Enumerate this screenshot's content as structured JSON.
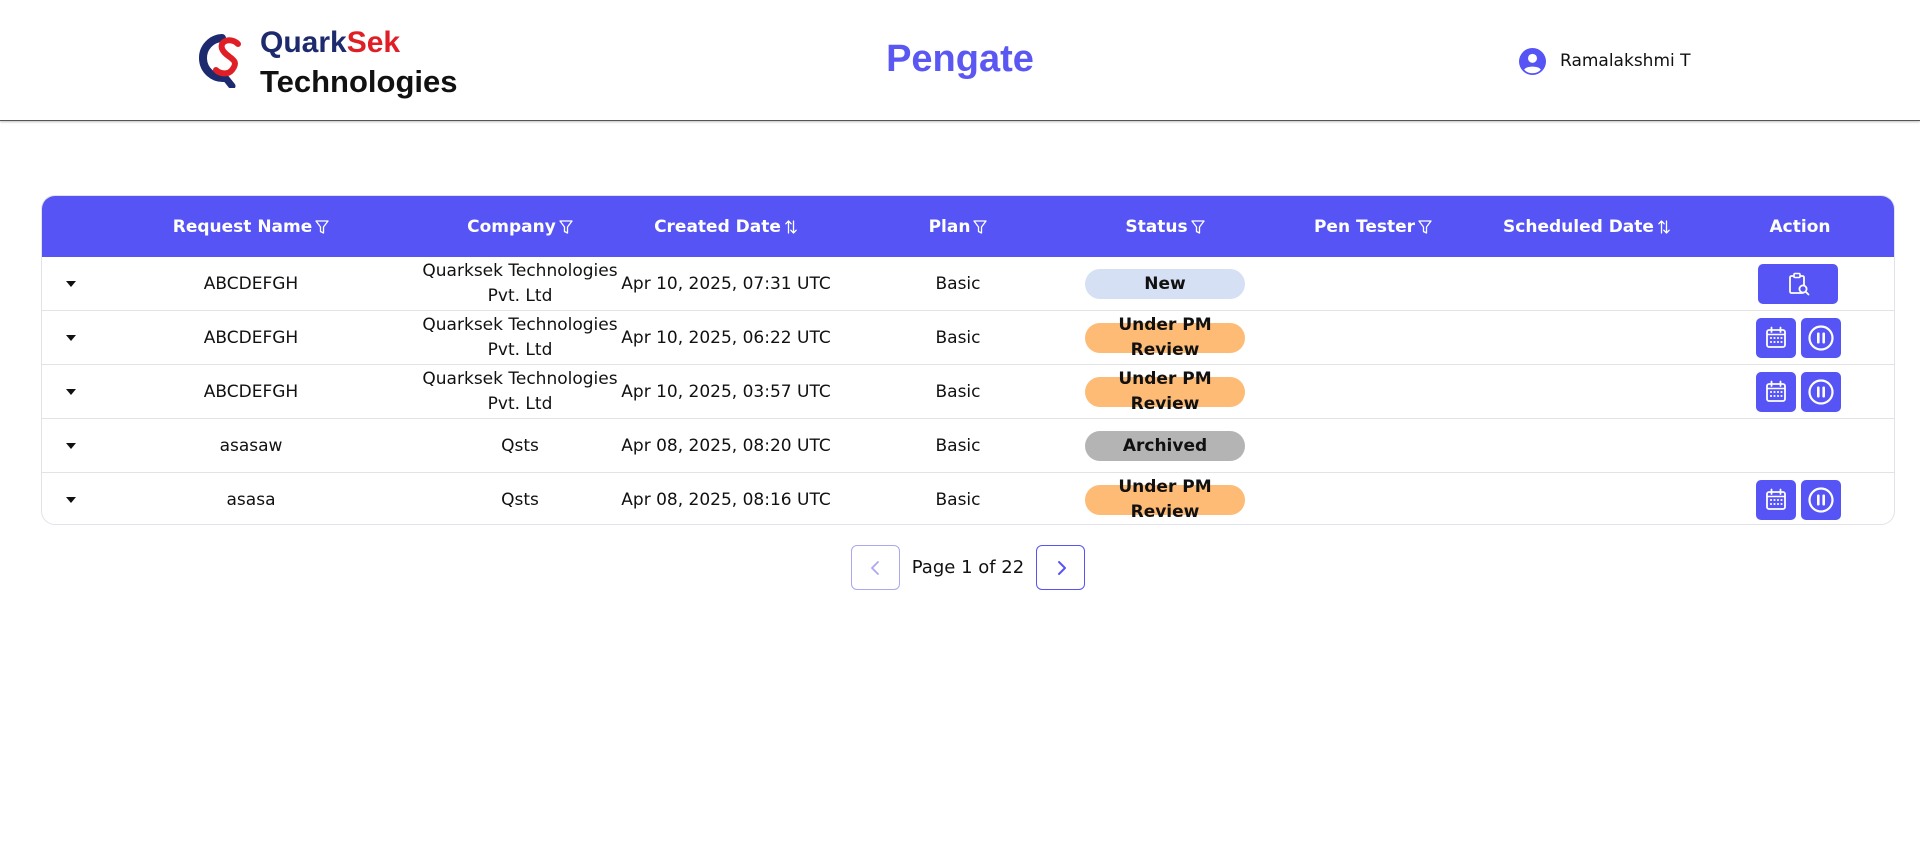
{
  "header": {
    "logo": {
      "word1": "Quark",
      "word2": "Sek",
      "word3": "Technologies"
    },
    "app_title": "Pengate",
    "user": {
      "name": "Ramalakshmi T",
      "icon": "user-circle-icon"
    }
  },
  "colors": {
    "accent": "#5654f5",
    "title": "#5a57f2",
    "logo_navy": "#1e2a6e",
    "logo_red": "#e01e25",
    "badge_new": "#d6e0f4",
    "badge_review": "#fdbb75",
    "badge_archived": "#b4b4b4"
  },
  "table": {
    "columns": [
      {
        "label": "Request Name",
        "icon": "filter-icon"
      },
      {
        "label": "Company",
        "icon": "filter-icon"
      },
      {
        "label": "Created Date",
        "icon": "sort-icon"
      },
      {
        "label": "Plan",
        "icon": "filter-icon"
      },
      {
        "label": "Status",
        "icon": "filter-icon"
      },
      {
        "label": "Pen Tester",
        "icon": "filter-icon"
      },
      {
        "label": "Scheduled Date",
        "icon": "sort-icon"
      },
      {
        "label": "Action",
        "icon": ""
      }
    ],
    "rows": [
      {
        "request_name": "ABCDEFGH",
        "company_line1": "Quarksek Technologies",
        "company_line2": "Pvt. Ltd",
        "created_date": "Apr 10, 2025, 07:31 UTC",
        "plan": "Basic",
        "status": "New",
        "pen_tester": "",
        "scheduled_date": "",
        "actions": [
          "view-request-icon"
        ]
      },
      {
        "request_name": "ABCDEFGH",
        "company_line1": "Quarksek Technologies",
        "company_line2": "Pvt. Ltd",
        "created_date": "Apr 10, 2025, 06:22 UTC",
        "plan": "Basic",
        "status": "Under PM Review",
        "pen_tester": "",
        "scheduled_date": "",
        "actions": [
          "calendar-icon",
          "pause-icon"
        ]
      },
      {
        "request_name": "ABCDEFGH",
        "company_line1": "Quarksek Technologies",
        "company_line2": "Pvt. Ltd",
        "created_date": "Apr 10, 2025, 03:57 UTC",
        "plan": "Basic",
        "status": "Under PM Review",
        "pen_tester": "",
        "scheduled_date": "",
        "actions": [
          "calendar-icon",
          "pause-icon"
        ]
      },
      {
        "request_name": "asasaw",
        "company_line1": "Qsts",
        "company_line2": "",
        "created_date": "Apr 08, 2025, 08:20 UTC",
        "plan": "Basic",
        "status": "Archived",
        "pen_tester": "",
        "scheduled_date": "",
        "actions": []
      },
      {
        "request_name": "asasa",
        "company_line1": "Qsts",
        "company_line2": "",
        "created_date": "Apr 08, 2025, 08:16 UTC",
        "plan": "Basic",
        "status": "Under PM Review",
        "pen_tester": "",
        "scheduled_date": "",
        "actions": [
          "calendar-icon",
          "pause-icon"
        ]
      }
    ]
  },
  "pagination": {
    "text": "Page 1 of 22",
    "prev_icon": "chevron-left-icon",
    "next_icon": "chevron-right-icon"
  }
}
